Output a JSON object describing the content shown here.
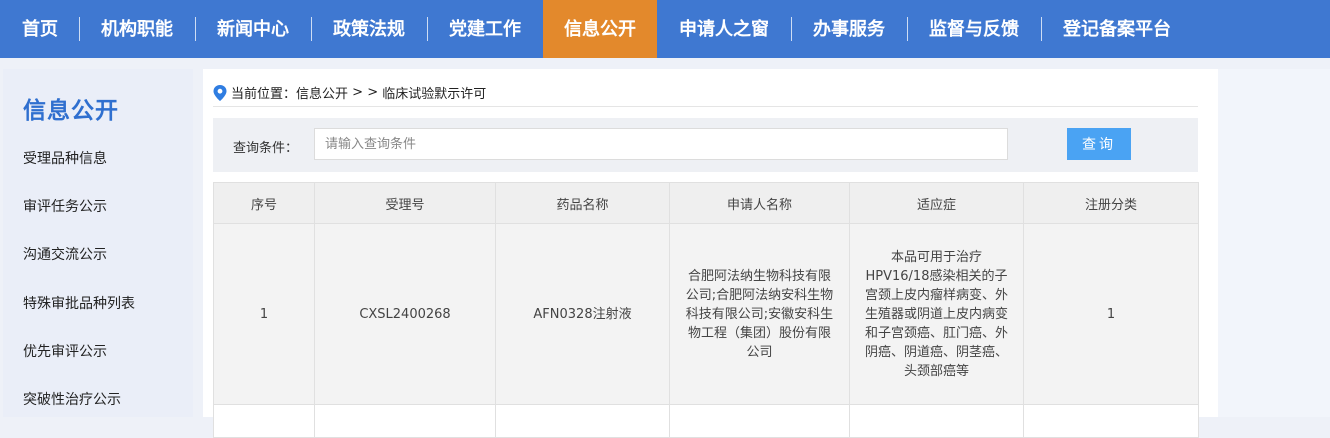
{
  "nav": {
    "items": [
      {
        "label": "首页"
      },
      {
        "label": "机构职能"
      },
      {
        "label": "新闻中心"
      },
      {
        "label": "政策法规"
      },
      {
        "label": "党建工作"
      },
      {
        "label": "信息公开"
      },
      {
        "label": "申请人之窗"
      },
      {
        "label": "办事服务"
      },
      {
        "label": "监督与反馈"
      },
      {
        "label": "登记备案平台"
      }
    ],
    "active_index": 5,
    "color": "#3f78d1",
    "active_color": "#e3892c"
  },
  "sidebar": {
    "title": "信息公开",
    "items": [
      {
        "label": "受理品种信息"
      },
      {
        "label": "审评任务公示"
      },
      {
        "label": "沟通交流公示"
      },
      {
        "label": "特殊审批品种列表"
      },
      {
        "label": "优先审评公示"
      },
      {
        "label": "突破性治疗公示"
      }
    ]
  },
  "breadcrumb": {
    "prefix": "当前位置：",
    "section": "信息公开",
    "separator": " > > ",
    "current": "临床试验默示许可",
    "icon": "location-pin-icon"
  },
  "query": {
    "label": "查询条件：",
    "placeholder": "请输入查询条件",
    "value": "",
    "button": "查询"
  },
  "table": {
    "headers": [
      "序号",
      "受理号",
      "药品名称",
      "申请人名称",
      "适应症",
      "注册分类"
    ],
    "rows": [
      {
        "index": "1",
        "acceptance_no": "CXSL2400268",
        "drug_name": "AFN0328注射液",
        "applicant": "合肥阿法纳生物科技有限公司;合肥阿法纳安科生物科技有限公司;安徽安科生物工程（集团）股份有限公司",
        "indication": "本品可用于治疗HPV16/18感染相关的子宫颈上皮内瘤样病变、外生殖器或阴道上皮内病变和子宫颈癌、肛门癌、外阴癌、阴道癌、阴茎癌、头颈部癌等",
        "category": "1"
      },
      {
        "index": "",
        "acceptance_no": "",
        "drug_name": "",
        "applicant": "",
        "indication": "",
        "category": ""
      }
    ]
  }
}
